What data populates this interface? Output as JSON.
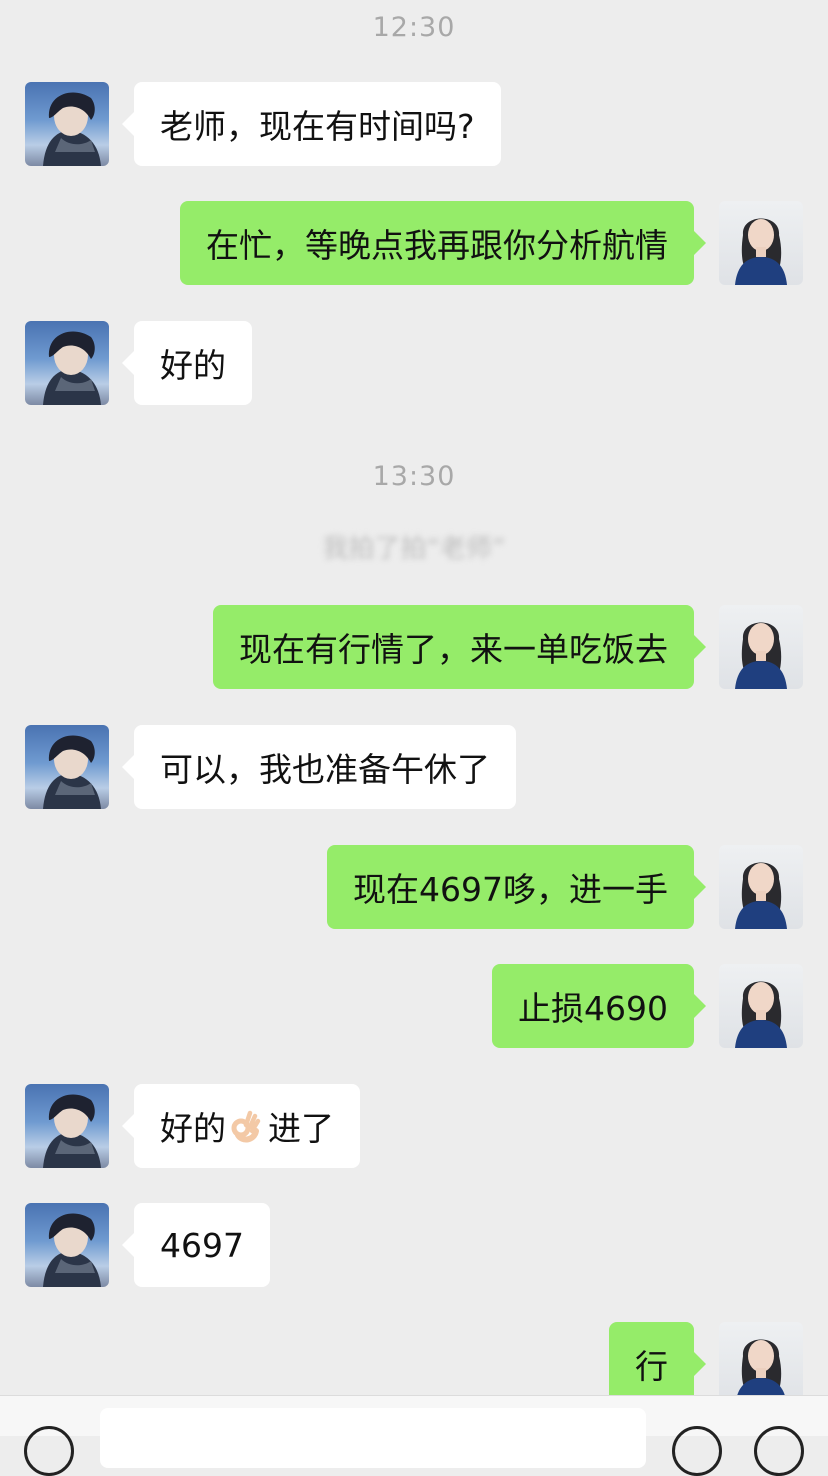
{
  "timestamps": [
    "12:30",
    "13:30"
  ],
  "system_notice": "我拍了拍“老师”",
  "messages": [
    {
      "side": "left",
      "text": "老师，现在有时间吗?"
    },
    {
      "side": "right",
      "text": "在忙，等晚点我再跟你分析航情"
    },
    {
      "side": "left",
      "text": "好的"
    },
    {
      "side": "right",
      "text": "现在有行情了，来一单吃饭去"
    },
    {
      "side": "left",
      "text": "可以，我也准备午休了"
    },
    {
      "side": "right",
      "text": "现在4697哆，进一手"
    },
    {
      "side": "right",
      "text": "止损4690"
    },
    {
      "side": "left",
      "text_before": "好的",
      "emoji": "ok-hand",
      "text_after": "进了"
    },
    {
      "side": "left",
      "text": "4697"
    },
    {
      "side": "right",
      "text": "行"
    }
  ],
  "colors": {
    "background": "#ededed",
    "sent_bubble": "#95ec69",
    "received_bubble": "#ffffff",
    "timestamp": "#a8a8a8"
  },
  "icons": {
    "input_left": "voice-icon",
    "input_right_1": "emoji-icon",
    "input_right_2": "add-icon"
  }
}
